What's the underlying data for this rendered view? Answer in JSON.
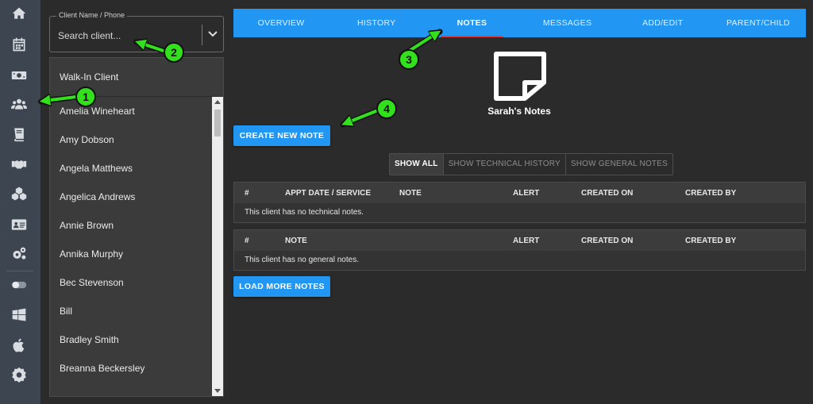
{
  "rail": {
    "icons": [
      "home-icon",
      "calendar-icon",
      "money-icon",
      "clients-icon",
      "book-icon",
      "handshake-icon",
      "products-icon",
      "id-card-icon",
      "settings-icon",
      "toggle-icon",
      "windows-icon",
      "apple-icon",
      "gear-badge-icon"
    ],
    "color": "#3d4650"
  },
  "client_search": {
    "label": "Client Name / Phone",
    "placeholder": "Search client...",
    "value": ""
  },
  "client_list": {
    "walk_in": "Walk-In Client",
    "items": [
      "Amelia Wineheart",
      "Amy Dobson",
      "Angela Matthews",
      "Angelica Andrews",
      "Annie Brown",
      "Annika Murphy",
      "Bec Stevenson",
      "Bill",
      "Bradley Smith",
      "Breanna Beckersley"
    ]
  },
  "tabs": {
    "items": [
      "OVERVIEW",
      "HISTORY",
      "NOTES",
      "MESSAGES",
      "ADD/EDIT",
      "PARENT/CHILD"
    ],
    "active": "NOTES",
    "color": "#2196f3"
  },
  "notes": {
    "title": "Sarah's Notes",
    "create_label": "CREATE NEW NOTE",
    "load_more_label": "LOAD MORE NOTES",
    "filters": [
      "SHOW ALL",
      "SHOW TECHNICAL HISTORY",
      "SHOW GENERAL NOTES"
    ],
    "active_filter": "SHOW ALL"
  },
  "technical_table": {
    "headers": [
      "#",
      "APPT DATE / SERVICE",
      "NOTE",
      "ALERT",
      "CREATED ON",
      "CREATED BY"
    ],
    "empty_message": "This client has no technical notes."
  },
  "general_table": {
    "headers": [
      "#",
      "NOTE",
      "ALERT",
      "CREATED ON",
      "CREATED BY"
    ],
    "empty_message": "This client has no general notes."
  },
  "annotations": {
    "badges": [
      "1",
      "2",
      "3",
      "4"
    ],
    "color": "#33e01d"
  }
}
